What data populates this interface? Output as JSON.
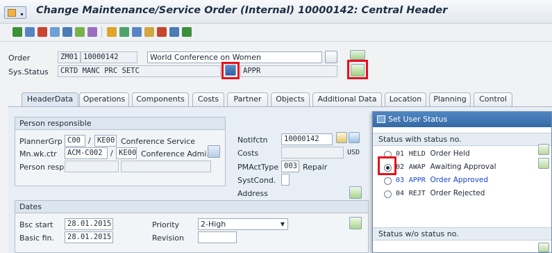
{
  "title": "Change Maintenance/Service Order (Internal) 10000142: Central Header",
  "header": {
    "order_label": "Order",
    "order_type": "ZM01",
    "order_number": "10000142",
    "order_description": "World Conference on Women",
    "sys_status_label": "Sys.Status",
    "sys_status_value": "CRTD MANC PRC  SETC",
    "user_status_value": "APPR"
  },
  "tabs": [
    {
      "label": "HeaderData"
    },
    {
      "label": "Operations"
    },
    {
      "label": "Components"
    },
    {
      "label": "Costs"
    },
    {
      "label": "Partner"
    },
    {
      "label": "Objects"
    },
    {
      "label": "Additional Data"
    },
    {
      "label": "Location"
    },
    {
      "label": "Planning"
    },
    {
      "label": "Control"
    }
  ],
  "person_responsible": {
    "title": "Person responsible",
    "planner_grp_label": "PlannerGrp",
    "planner_grp": "C00",
    "planner_plant": "KE00",
    "planner_text": "Conference Service",
    "mn_wk_ctr_label": "Mn.wk.ctr",
    "mn_wk_ctr": "ACM-C002",
    "mn_wk_ctr_plant": "KE00",
    "mn_wk_ctr_text": "Conference Admi...",
    "person_resp_label": "Person resp."
  },
  "notif": {
    "notifctn_label": "Notifctn",
    "notifctn": "10000142",
    "costs_label": "Costs",
    "costs_currency": "USD",
    "pmacttype_label": "PMActType",
    "pmacttype": "003",
    "pmacttype_text": "Repair",
    "systcond_label": "SystCond.",
    "address_label": "Address"
  },
  "dates": {
    "title": "Dates",
    "bsc_start_label": "Bsc start",
    "bsc_start": "28.01.2015",
    "basic_fin_label": "Basic fin.",
    "basic_fin": "28.01.2015",
    "priority_label": "Priority",
    "priority": "2-High",
    "revision_label": "Revision"
  },
  "dialog": {
    "title": "Set User Status",
    "with_no_label": "Status with status no.",
    "without_no_label": "Status w/o status no.",
    "statuses": [
      {
        "num": "01",
        "code": "HELD",
        "text": "Order Held",
        "selected": false
      },
      {
        "num": "02",
        "code": "AWAP",
        "text": "Awaiting Approval",
        "selected": true
      },
      {
        "num": "03",
        "code": "APPR",
        "text": "Order Approved",
        "selected": false
      },
      {
        "num": "04",
        "code": "REJT",
        "text": "Order Rejected",
        "selected": false
      }
    ]
  },
  "colors": {
    "highlight_box": "#e8101a",
    "dialog_title_bg": "#3569a4",
    "active_status_text": "#1946c6"
  }
}
